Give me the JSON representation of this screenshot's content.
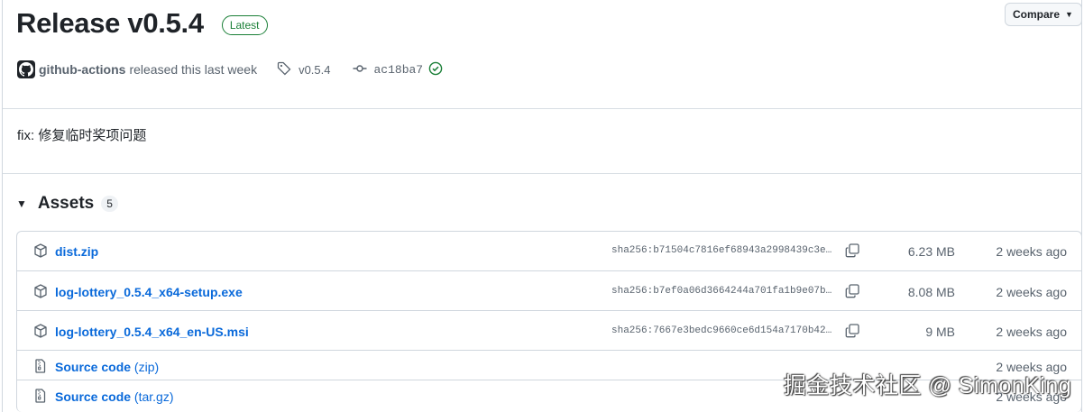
{
  "release": {
    "title": "Release v0.5.4",
    "latest_badge": "Latest",
    "compare_label": "Compare",
    "author": "github-actions",
    "released_text": "released this last week",
    "tag": "v0.5.4",
    "commit": "ac18ba7",
    "body": "fix: 修复临时奖项问题"
  },
  "assets": {
    "title": "Assets",
    "count": "5",
    "rows": [
      {
        "name": "dist.zip",
        "sha": "sha256:b71504c7816ef68943a2998439c3e…",
        "size": "6.23 MB",
        "date": "2 weeks ago"
      },
      {
        "name": "log-lottery_0.5.4_x64-setup.exe",
        "sha": "sha256:b7ef0a06d3664244a701fa1b9e07b…",
        "size": "8.08 MB",
        "date": "2 weeks ago"
      },
      {
        "name": "log-lottery_0.5.4_x64_en-US.msi",
        "sha": "sha256:7667e3bedc9660ce6d154a7170b42…",
        "size": "9 MB",
        "date": "2 weeks ago"
      },
      {
        "name": "Source code",
        "suffix": "(zip)",
        "date": "2 weeks ago"
      },
      {
        "name": "Source code",
        "suffix": "(tar.gz)",
        "date": "2 weeks ago"
      }
    ]
  },
  "watermark": "掘金技术社区 @ SimonKing",
  "colors": {
    "link": "#0969da",
    "latest": "#1a7f37",
    "check": "#1a7f37",
    "muted": "#59636e"
  },
  "icons": [
    "tag-icon",
    "commit-icon",
    "check-circle-icon",
    "package-icon",
    "file-zip-icon",
    "copy-icon",
    "github-avatar"
  ]
}
